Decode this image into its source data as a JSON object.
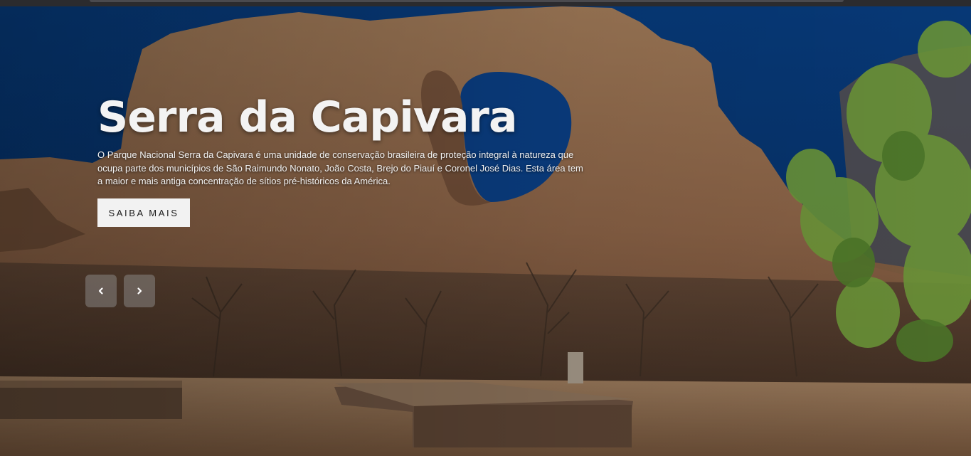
{
  "hero": {
    "title": "Serra da Capivara",
    "description": "O Parque Nacional Serra da Capivara é uma unidade de conservação brasileira de proteção integral à natureza que ocupa parte dos municípios de São Raimundo Nonato, João Costa, Brejo do Piauí e Coronel José Dias. Esta área tem a maior e mais antiga concentração de sítios pré-históricos da América.",
    "cta_label": "SAIBA MAIS"
  },
  "carousel": {
    "prev_icon": "chevron-left-icon",
    "next_icon": "chevron-right-icon"
  },
  "colors": {
    "sky": "#06326b",
    "rock": "#8a6446",
    "ground": "#8d6d50",
    "button_bg": "#f2f2f2",
    "nav_bg": "rgba(150,150,150,0.45)"
  }
}
